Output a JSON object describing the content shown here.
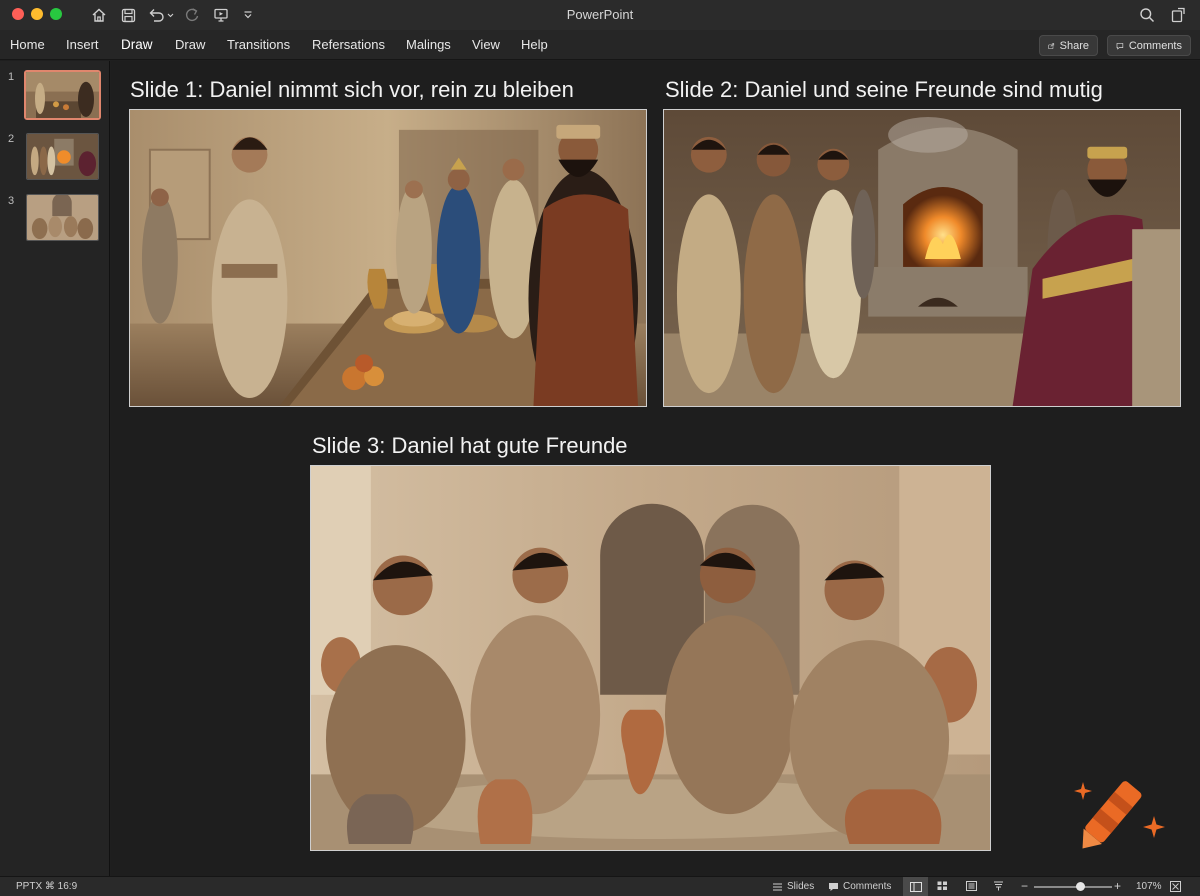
{
  "window": {
    "title": "PowerPoint"
  },
  "ribbon": {
    "tabs": [
      "Home",
      "Insert",
      "Draw",
      "Draw",
      "Transitions",
      "Refersations",
      "Malings",
      "View",
      "Help"
    ],
    "share_label": "Share",
    "comments_label": "Comments"
  },
  "thumbnails": [
    {
      "number": "1"
    },
    {
      "number": "2"
    },
    {
      "number": "3"
    }
  ],
  "slides": [
    {
      "title": "Slide 1: Daniel nimmt sich vor, rein zu bleiben",
      "image": "Daniel stands at a banquet table with food and golden jugs, speaking to Babylonian officials"
    },
    {
      "title": "Slide 2: Daniel und seine Freunde sind mutig",
      "image": "Three young men stand before a seated king next to a burning furnace"
    },
    {
      "title": "Slide 3: Daniel hat gute Freunde",
      "image": "Four young men sit together talking among clay pots in a stone courtyard"
    }
  ],
  "statusbar": {
    "file_info": "PPTX ⌘ 16:9",
    "slides_label": "Slides",
    "comments_label": "Comments",
    "zoom_text": "107%",
    "zoom_level": 0.6
  },
  "colors": {
    "accent": "#e0866d",
    "window_bg": "#1f1f1f",
    "brand_orange": "#ea6a25"
  },
  "icons": [
    "home-icon",
    "save-icon",
    "undo-icon",
    "redo-icon",
    "present-icon",
    "customize-icon",
    "search-icon",
    "share-window-icon",
    "share-icon",
    "comment-icon",
    "crayon-icon",
    "sparkle-icon"
  ]
}
